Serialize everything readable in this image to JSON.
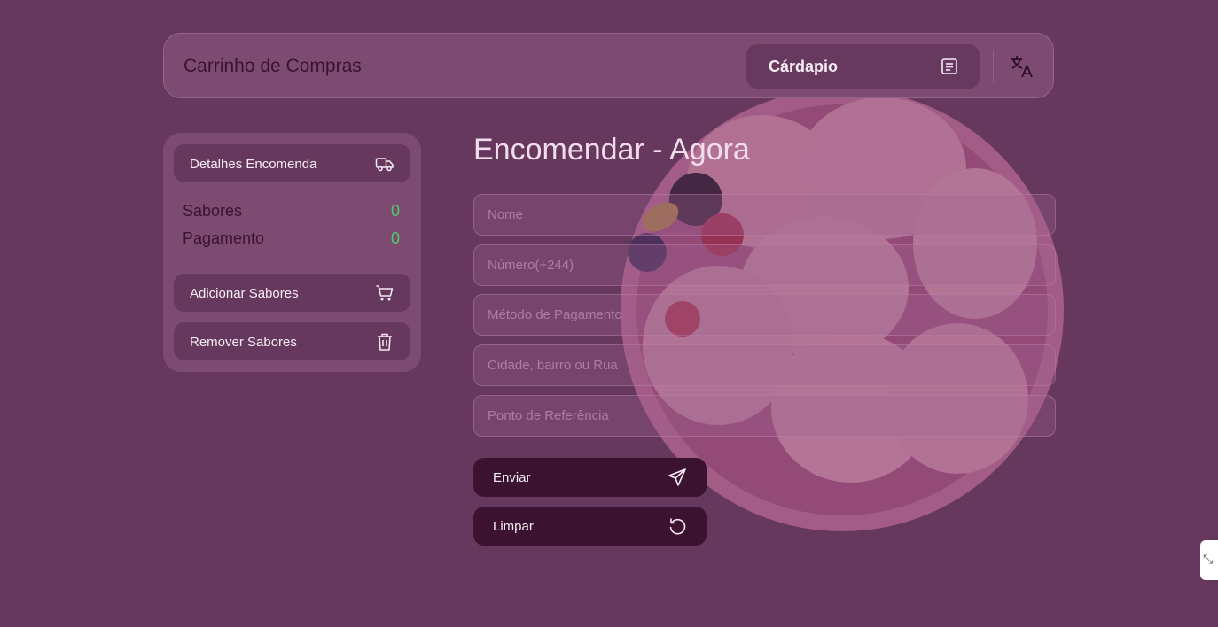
{
  "header": {
    "title": "Carrinho de Compras",
    "menu_label": "Cárdapio",
    "menu_icon": "menu-list-icon",
    "language_icon": "translate-icon"
  },
  "sidebar": {
    "details_label": "Detalhes Encomenda",
    "details_icon": "truck-icon",
    "stats": [
      {
        "label": "Sabores",
        "value": "0"
      },
      {
        "label": "Pagamento",
        "value": "0"
      }
    ],
    "add_label": "Adicionar Sabores",
    "add_icon": "cart-icon",
    "remove_label": "Remover Sabores",
    "remove_icon": "trash-icon"
  },
  "form": {
    "title": "Encomendar - Agora",
    "fields": [
      {
        "placeholder": "Nome",
        "value": ""
      },
      {
        "placeholder": "Número(+244)",
        "value": ""
      },
      {
        "placeholder": "Método de Pagamento",
        "value": ""
      },
      {
        "placeholder": "Cidade, bairro ou Rua",
        "value": ""
      },
      {
        "placeholder": "Ponto de Referência",
        "value": ""
      }
    ],
    "submit_label": "Enviar",
    "submit_icon": "send-icon",
    "clear_label": "Limpar",
    "clear_icon": "reset-icon"
  },
  "colors": {
    "background": "#66385d",
    "card": "#7d4b72",
    "dark_button": "#3b1330",
    "counter": "#4cd06a"
  }
}
